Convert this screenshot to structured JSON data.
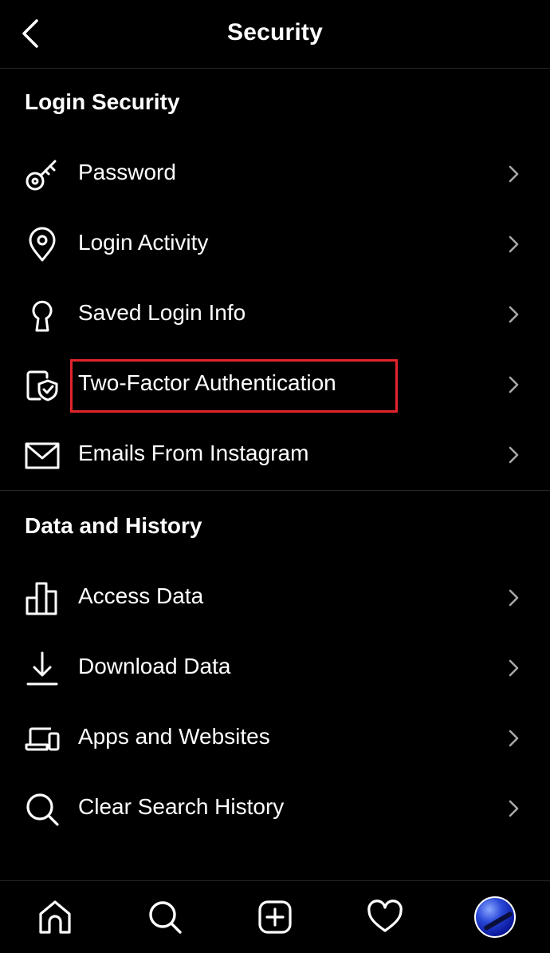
{
  "header": {
    "title": "Security"
  },
  "sections": [
    {
      "title": "Login Security",
      "items": [
        {
          "label": "Password",
          "icon": "key-icon"
        },
        {
          "label": "Login Activity",
          "icon": "location-pin-icon"
        },
        {
          "label": "Saved Login Info",
          "icon": "keyhole-icon"
        },
        {
          "label": "Two-Factor Authentication",
          "icon": "shield-check-icon"
        },
        {
          "label": "Emails From Instagram",
          "icon": "envelope-icon"
        }
      ]
    },
    {
      "title": "Data and History",
      "items": [
        {
          "label": "Access Data",
          "icon": "bar-chart-icon"
        },
        {
          "label": "Download Data",
          "icon": "download-icon"
        },
        {
          "label": "Apps and Websites",
          "icon": "devices-icon"
        },
        {
          "label": "Clear Search History",
          "icon": "search-icon"
        }
      ]
    }
  ],
  "bottom_nav": [
    "home-icon",
    "search-icon",
    "add-post-icon",
    "heart-icon",
    "profile-avatar"
  ],
  "colors": {
    "background": "#000000",
    "text": "#ffffff",
    "divider": "#262626",
    "highlight": "#e0252a",
    "chevron": "#a8a8a8"
  }
}
